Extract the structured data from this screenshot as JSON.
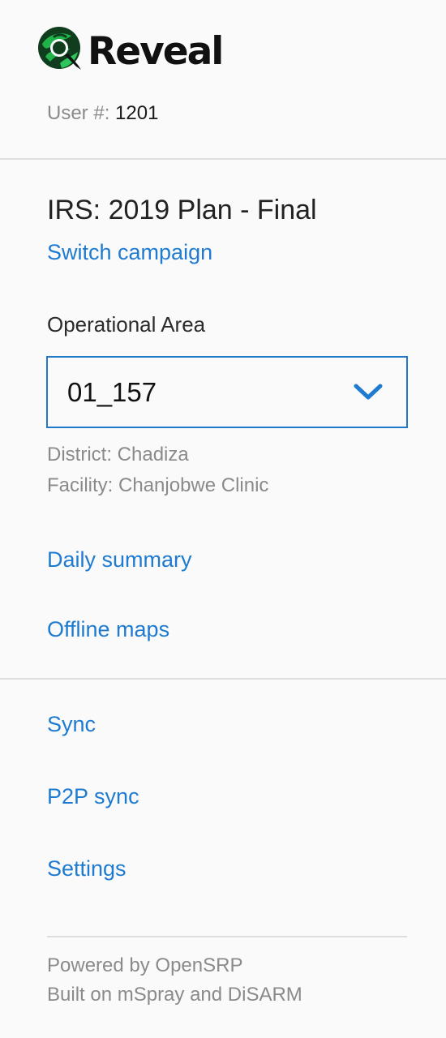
{
  "app": {
    "logo_text": "Reveal"
  },
  "user": {
    "label": "User #:",
    "number": "1201"
  },
  "campaign": {
    "title": "IRS: 2019 Plan - Final",
    "switch_label": "Switch campaign"
  },
  "operational_area": {
    "label": "Operational Area",
    "selected": "01_157",
    "district": "District: Chadiza",
    "facility": "Facility: Chanjobwe Clinic"
  },
  "menu": {
    "daily_summary": "Daily summary",
    "offline_maps": "Offline maps",
    "sync": "Sync",
    "p2p_sync": "P2P sync",
    "settings": "Settings"
  },
  "footer": {
    "powered_by": "Powered by OpenSRP",
    "built_on": "Built on mSpray and DiSARM"
  },
  "colors": {
    "accent": "#1e7bd0",
    "border": "#1f78c8",
    "logo_green": "#1a9e3a",
    "logo_dark": "#0f3d1d"
  }
}
